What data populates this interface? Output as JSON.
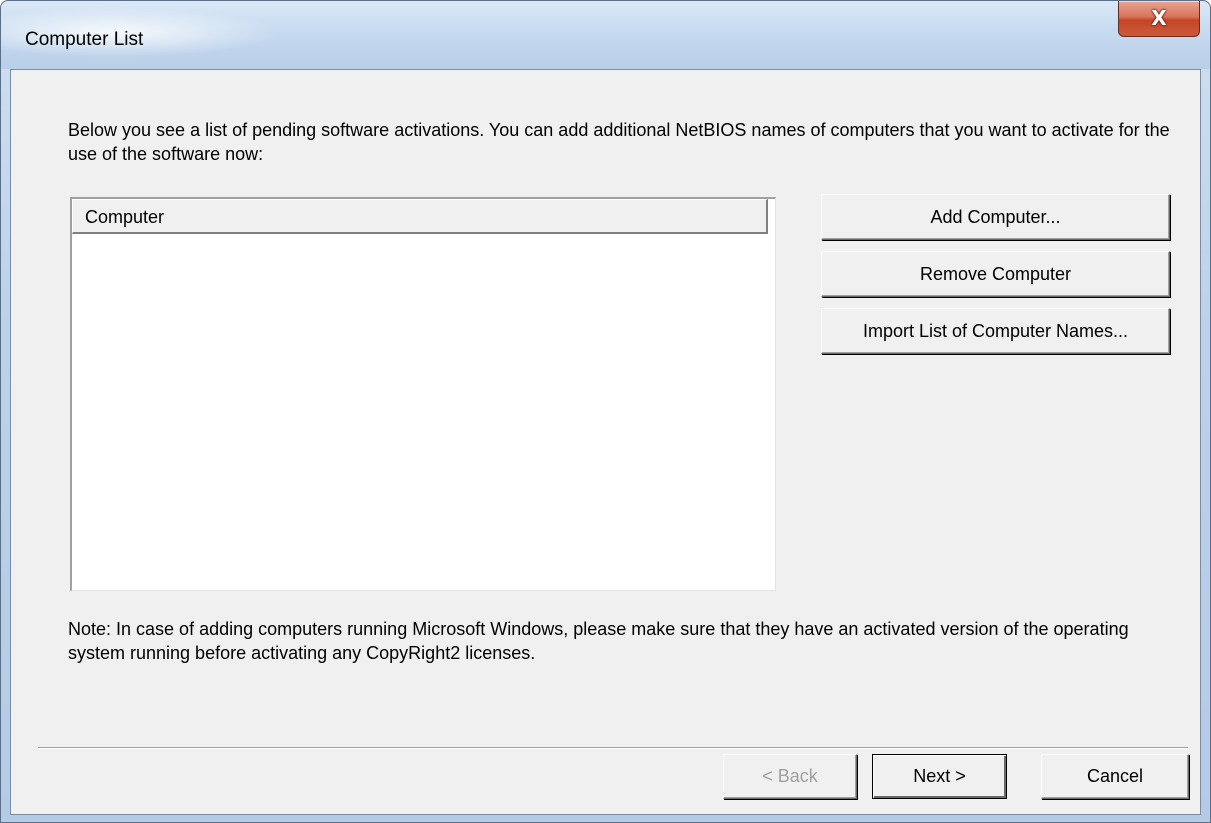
{
  "window": {
    "title": "Computer List",
    "close_label": "X"
  },
  "main": {
    "description": "Below you see a list of pending software activations. You can add additional NetBIOS names of computers that you want to activate for the use of the software now:",
    "list": {
      "columns": [
        "Computer"
      ],
      "rows": []
    },
    "buttons": {
      "add_computer": "Add Computer...",
      "remove_computer": "Remove Computer",
      "import_list": "Import List of Computer Names..."
    },
    "note": "Note: In case of adding computers running Microsoft Windows, please make sure that they have an activated version of the operating system running before activating any CopyRight2 licenses."
  },
  "footer": {
    "back_label": "< Back",
    "next_label": "Next >",
    "cancel_label": "Cancel",
    "back_enabled": false
  },
  "colors": {
    "dialog_face": "#f0f0f0",
    "close_button": "#c44526",
    "title_bar": "#c6daf0"
  }
}
